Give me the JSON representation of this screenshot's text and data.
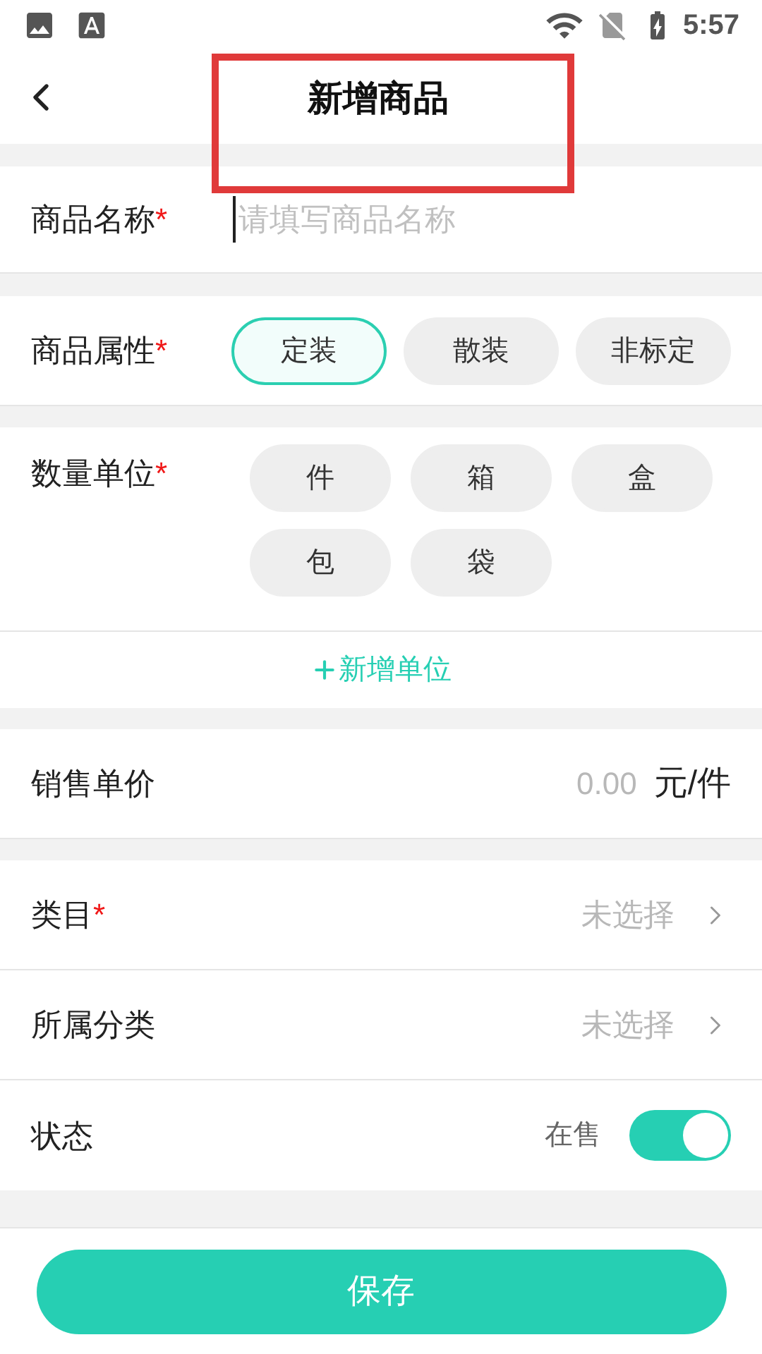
{
  "status_bar": {
    "time": "5:57"
  },
  "header": {
    "title": "新增商品"
  },
  "form": {
    "name": {
      "label": "商品名称",
      "required_mark": "*",
      "placeholder": "请填写商品名称"
    },
    "attribute": {
      "label": "商品属性",
      "required_mark": "*",
      "options": [
        {
          "label": "定装",
          "selected": true
        },
        {
          "label": "散装",
          "selected": false
        },
        {
          "label": "非标定",
          "selected": false
        }
      ]
    },
    "units": {
      "label": "数量单位",
      "required_mark": "*",
      "options": [
        {
          "label": "件",
          "selected": false
        },
        {
          "label": "箱",
          "selected": false
        },
        {
          "label": "盒",
          "selected": false
        },
        {
          "label": "包",
          "selected": false
        },
        {
          "label": "袋",
          "selected": false
        }
      ],
      "add_label": "新增单位"
    },
    "price": {
      "label": "销售单价",
      "value": "0.00",
      "unit": "元/件"
    },
    "category": {
      "label": "类目",
      "required_mark": "*",
      "value": "未选择"
    },
    "classification": {
      "label": "所属分类",
      "value": "未选择"
    },
    "status": {
      "label": "状态",
      "value": "在售",
      "on": true
    }
  },
  "save_button": "保存"
}
